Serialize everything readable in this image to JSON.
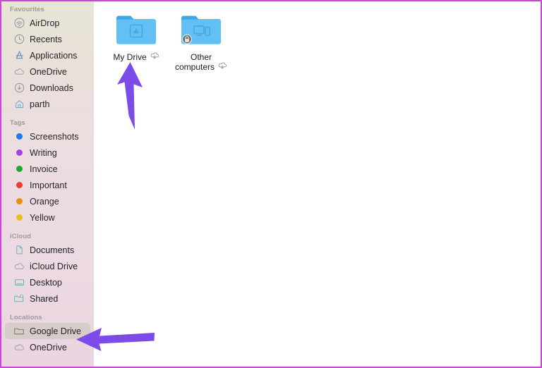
{
  "window": {
    "border_color": "#cc45dd",
    "background": "#ffffff"
  },
  "sidebar": {
    "background_top": "#e8e4d6",
    "background_bottom": "#ead5df",
    "selected_row_color": "#d6cdc9",
    "sections": [
      {
        "header": "Favourites",
        "items": [
          {
            "label": "AirDrop",
            "icon": "airdrop-icon",
            "selected": false
          },
          {
            "label": "Recents",
            "icon": "clock-icon",
            "selected": false
          },
          {
            "label": "Applications",
            "icon": "applications-icon",
            "selected": false
          },
          {
            "label": "OneDrive",
            "icon": "cloud-icon",
            "selected": false
          },
          {
            "label": "Downloads",
            "icon": "downloads-icon",
            "selected": false
          },
          {
            "label": "parth",
            "icon": "home-icon",
            "selected": false
          }
        ]
      },
      {
        "header": "Tags",
        "items": [
          {
            "label": "Screenshots",
            "icon": "tag-dot-icon",
            "color": "#1c7ced",
            "selected": false
          },
          {
            "label": "Writing",
            "icon": "tag-dot-icon",
            "color": "#a444e0",
            "selected": false
          },
          {
            "label": "Invoice",
            "icon": "tag-dot-icon",
            "color": "#18ac2e",
            "selected": false
          },
          {
            "label": "Important",
            "icon": "tag-dot-icon",
            "color": "#e8402f",
            "selected": false
          },
          {
            "label": "Orange",
            "icon": "tag-dot-icon",
            "color": "#e8920f",
            "selected": false
          },
          {
            "label": "Yellow",
            "icon": "tag-dot-icon",
            "color": "#ecbe17",
            "selected": false
          }
        ]
      },
      {
        "header": "iCloud",
        "items": [
          {
            "label": "Documents",
            "icon": "document-icon",
            "selected": false
          },
          {
            "label": "iCloud Drive",
            "icon": "cloud-icon",
            "selected": false
          },
          {
            "label": "Desktop",
            "icon": "desktop-icon",
            "selected": false
          },
          {
            "label": "Shared",
            "icon": "shared-folder-icon",
            "selected": false
          }
        ]
      },
      {
        "header": "Locations",
        "items": [
          {
            "label": "Google Drive",
            "icon": "folder-icon",
            "selected": true
          },
          {
            "label": "OneDrive",
            "icon": "cloud-icon",
            "selected": false
          }
        ]
      }
    ]
  },
  "main": {
    "items": [
      {
        "name": "My Drive",
        "name_lines": [
          "My Drive"
        ],
        "folder_icon": "google-drive-folder-icon",
        "badge": "drive-triangle-badge",
        "status_icon": "cloud-download-icon",
        "locked": false,
        "folder_color": "#53b8f0"
      },
      {
        "name": "Other computers",
        "name_lines": [
          "Other",
          "computers"
        ],
        "folder_icon": "other-computers-folder-icon",
        "badge": "devices-badge",
        "status_icon": "cloud-download-icon",
        "locked": true,
        "folder_color": "#53b8f0"
      }
    ]
  },
  "annotations": {
    "color": "#7d4ce8",
    "arrows": [
      {
        "name": "arrow-pointing-to-my-drive",
        "direction": "up"
      },
      {
        "name": "arrow-pointing-to-google-drive",
        "direction": "left"
      }
    ]
  }
}
